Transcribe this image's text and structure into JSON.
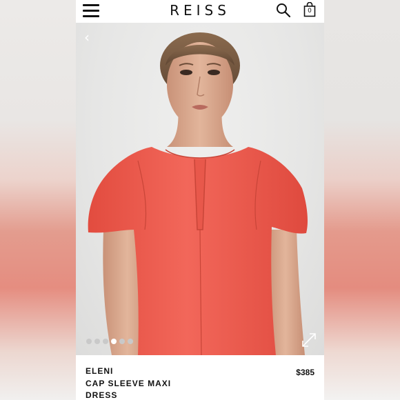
{
  "header": {
    "logo": "REISS",
    "menu_icon": "hamburger-menu-icon",
    "search_icon": "search-icon",
    "bag_icon": "shopping-bag-icon",
    "bag_count": "0"
  },
  "gallery": {
    "prev_icon": "chevron-left-icon",
    "prev_glyph": "‹",
    "image_description": "model wearing coral cap sleeve dress",
    "dot_count": 6,
    "active_dot": 4,
    "expand_icon": "expand-arrows-icon"
  },
  "product": {
    "brand": "ELENI",
    "name": "CAP SLEEVE MAXI DRESS",
    "price": "$385"
  },
  "colors": {
    "dress": "#ee5a4c",
    "skin": "#d9a78a",
    "text": "#111111"
  }
}
